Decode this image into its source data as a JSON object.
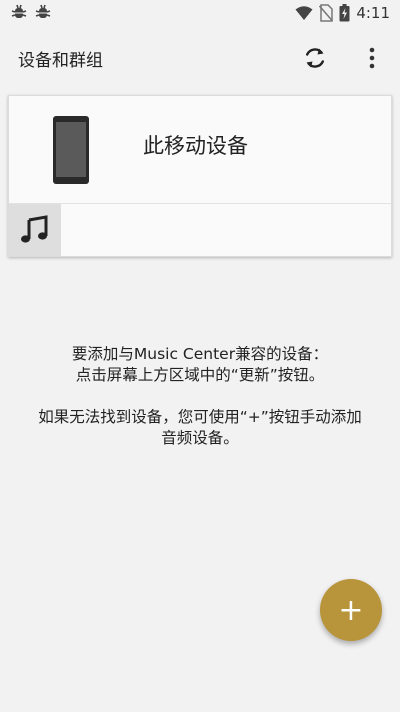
{
  "status_bar": {
    "time": "4:11",
    "left_icons": [
      "bug-icon",
      "bug-icon"
    ],
    "right_icons": [
      "wifi-icon",
      "no-sim-icon",
      "battery-icon"
    ]
  },
  "app_bar": {
    "title": "设备和群组",
    "actions": [
      "refresh-icon",
      "more-vert-icon"
    ]
  },
  "device_card": {
    "device_name": "此移动设备",
    "icon": "phone-icon",
    "music_icon": "music-note-icon"
  },
  "help": {
    "line1": "要添加与Music Center兼容的设备：",
    "line2": "点击屏幕上方区域中的“更新”按钮。",
    "line3": "如果无法找到设备，您可使用“+”按钮手动添加",
    "line4": "音频设备。"
  },
  "fab": {
    "label": "+",
    "color": "#b8943a"
  },
  "colors": {
    "background": "#f2f2f2",
    "accent": "#b8943a"
  }
}
